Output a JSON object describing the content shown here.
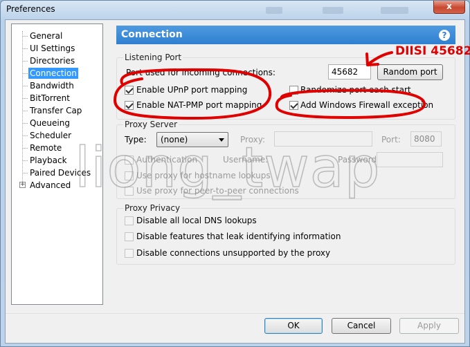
{
  "window": {
    "title": "Preferences",
    "close_glyph": "x"
  },
  "sidebar": {
    "items": [
      {
        "label": "General"
      },
      {
        "label": "UI Settings"
      },
      {
        "label": "Directories"
      },
      {
        "label": "Connection",
        "selected": true
      },
      {
        "label": "Bandwidth"
      },
      {
        "label": "BitTorrent"
      },
      {
        "label": "Transfer Cap"
      },
      {
        "label": "Queueing"
      },
      {
        "label": "Scheduler"
      },
      {
        "label": "Remote"
      },
      {
        "label": "Playback"
      },
      {
        "label": "Paired Devices"
      },
      {
        "label": "Advanced",
        "expandable": true
      }
    ]
  },
  "header": {
    "title": "Connection",
    "help_glyph": "?"
  },
  "listening_port": {
    "group_title": "Listening Port",
    "port_label": "Port used for incoming connections:",
    "port_value": "45682",
    "random_port_button": "Random port",
    "upnp": {
      "label": "Enable UPnP port mapping",
      "checked": true
    },
    "natpmp": {
      "label": "Enable NAT-PMP port mapping",
      "checked": true
    },
    "randomize": {
      "label": "Randomize port each start",
      "checked": false
    },
    "firewall": {
      "label": "Add Windows Firewall exception",
      "checked": true
    }
  },
  "proxy_server": {
    "group_title": "Proxy Server",
    "type_label": "Type:",
    "type_value": "(none)",
    "proxy_label": "Proxy:",
    "proxy_value": "",
    "port_label": "Port:",
    "port_value": "8080",
    "authentication": {
      "label": "Authentication",
      "checked": false
    },
    "username_label": "Username:",
    "password_label": "Password:",
    "hostname_lookups": {
      "label": "Use proxy for hostname lookups",
      "checked": false
    },
    "peer_connections": {
      "label": "Use proxy for peer-to-peer connections",
      "checked": false
    }
  },
  "proxy_privacy": {
    "group_title": "Proxy Privacy",
    "local_dns": {
      "label": "Disable all local DNS lookups",
      "checked": false
    },
    "leak_features": {
      "label": "Disable features that leak identifying information",
      "checked": false
    },
    "unsupported": {
      "label": "Disable connections unsupported by the proxy",
      "checked": false
    }
  },
  "footer": {
    "ok": "OK",
    "cancel": "Cancel",
    "apply": "Apply"
  },
  "annotation": {
    "text": "DIISI 45682",
    "color": "#e00000"
  },
  "watermark": {
    "text": "liong_twap"
  },
  "colors": {
    "accent": "#2f7fd1",
    "selection": "#3399ff",
    "annotation": "#e00000"
  }
}
